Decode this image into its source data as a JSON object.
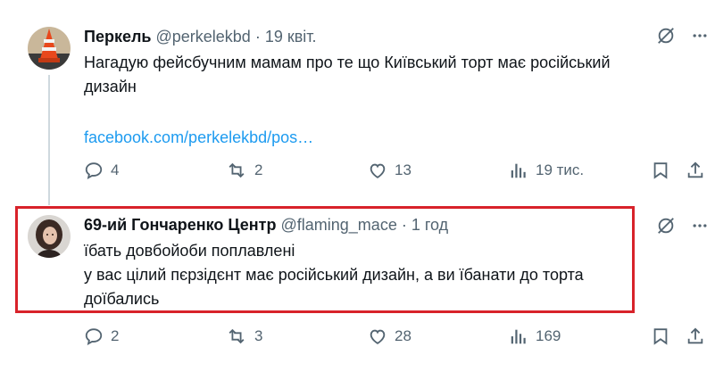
{
  "tweets": [
    {
      "author_name": "Перкель",
      "handle": "@perkelekbd",
      "separator": "·",
      "time": "19 квіт.",
      "text_lines": [
        "Нагадую фейсбучним мамам про те що Київський торт має російський",
        "дизайн"
      ],
      "link": "facebook.com/perkelekbd/pos…",
      "replies": "4",
      "reposts": "2",
      "likes": "13",
      "views": "19 тис."
    },
    {
      "author_name": "69-ий Гончаренко Центр",
      "handle": "@flaming_mace",
      "separator": "·",
      "time": "1 год",
      "text_lines": [
        "їбать довбойоби поплавлені",
        "у вас цілий пєрзідєнт має російський дизайн, а ви їбанати до торта",
        "доїбались"
      ],
      "replies": "2",
      "reposts": "3",
      "likes": "28",
      "views": "169"
    }
  ],
  "icons": {
    "grok": "grok-icon",
    "more": "more-icon",
    "reply": "reply-icon",
    "repost": "repost-icon",
    "like": "like-icon",
    "views": "views-icon",
    "bookmark": "bookmark-icon",
    "share": "share-icon"
  },
  "colors": {
    "link": "#1d9bf0",
    "muted": "#536471",
    "highlight": "#d8222a",
    "thread_line": "#cfd9de"
  }
}
